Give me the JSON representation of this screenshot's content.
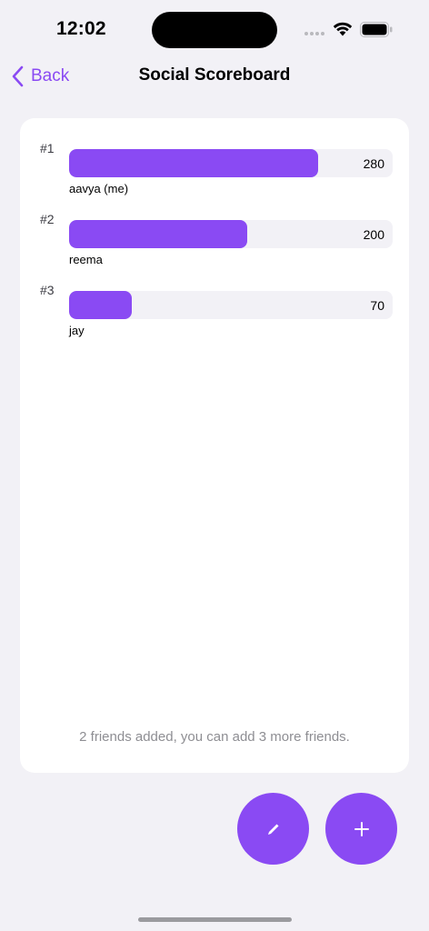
{
  "status_bar": {
    "time": "12:02"
  },
  "nav": {
    "back_label": "Back",
    "title": "Social Scoreboard"
  },
  "scoreboard": {
    "max_score": 280,
    "entries": [
      {
        "rank": "#1",
        "name": "aavya (me)",
        "score": "280",
        "value": 280
      },
      {
        "rank": "#2",
        "name": "reema",
        "score": "200",
        "value": 200
      },
      {
        "rank": "#3",
        "name": "jay",
        "score": "70",
        "value": 70
      }
    ],
    "footer": "2 friends added, you can add 3 more friends."
  },
  "actions": {
    "edit_icon": "pencil-icon",
    "add_icon": "plus-icon"
  },
  "colors": {
    "accent": "#8a4af3",
    "track": "#f2f1f6",
    "background": "#f2f1f6"
  }
}
